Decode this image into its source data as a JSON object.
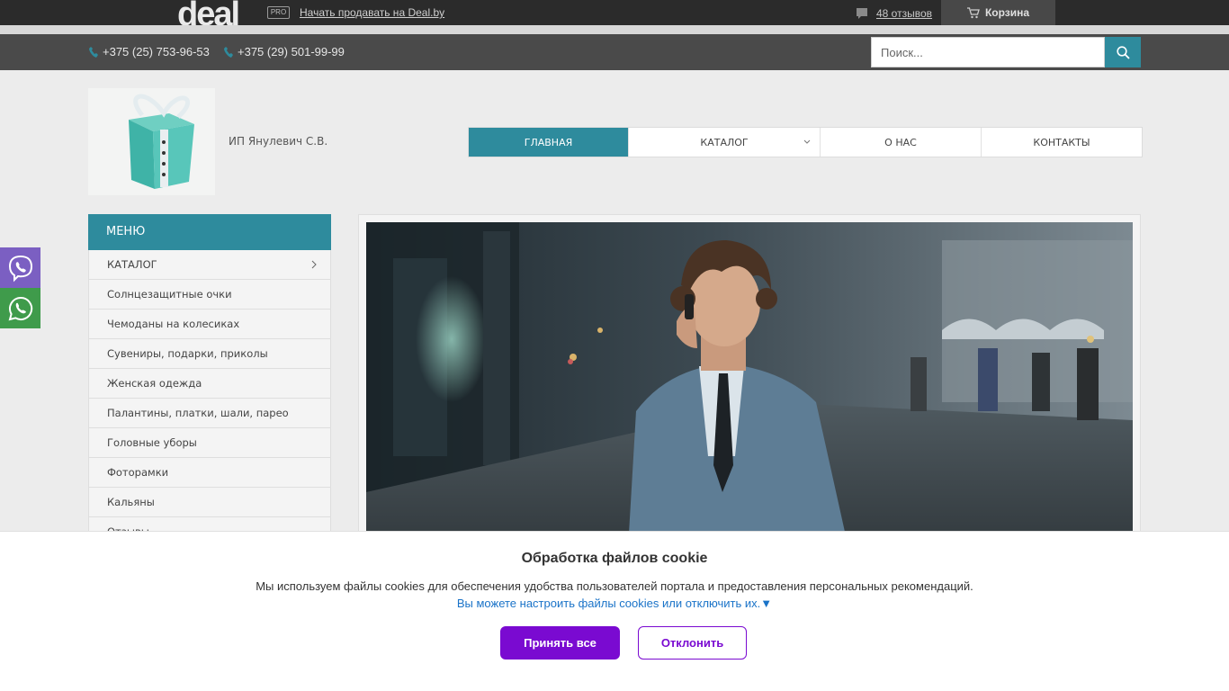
{
  "topbar": {
    "logo": "deal",
    "pro_badge": "PRO",
    "sell_link": "Начать продавать на Deal.by",
    "reviews": "48 отзывов",
    "cart": "Корзина"
  },
  "contacts": {
    "phone1": "+375 (25) 753-96-53",
    "phone2": "+375 (29) 501-99-99"
  },
  "search": {
    "placeholder": "Поиск..."
  },
  "company": {
    "name": "ИП Янулевич С.В."
  },
  "nav": {
    "items": [
      {
        "label": "Главная",
        "active": true
      },
      {
        "label": "Каталог",
        "dropdown": true
      },
      {
        "label": "О нас"
      },
      {
        "label": "Контакты"
      }
    ]
  },
  "sidebar": {
    "title": "Меню",
    "items": [
      {
        "label": "КАТАЛОГ"
      },
      {
        "label": "Солнцезащитные очки"
      },
      {
        "label": "Чемоданы на колесиках"
      },
      {
        "label": "Сувениры, подарки, приколы"
      },
      {
        "label": "Женская одежда"
      },
      {
        "label": "Палантины, платки, шали, парео"
      },
      {
        "label": "Головные уборы"
      },
      {
        "label": "Фоторамки"
      },
      {
        "label": "Кальяны"
      },
      {
        "label": "Отзывы"
      }
    ]
  },
  "cookie": {
    "title": "Обработка файлов cookie",
    "text": "Мы используем файлы cookies для обеспечения удобства пользователей портала и предоставления персональных рекомендаций.",
    "link": "Вы можете настроить файлы cookies или отключить их.▼",
    "accept": "Принять все",
    "decline": "Отклонить"
  },
  "colors": {
    "accent": "#2e8b9d",
    "cookie_button": "#7a0ad1",
    "viber": "#7b5fc2",
    "whatsapp": "#3f9b4b"
  }
}
